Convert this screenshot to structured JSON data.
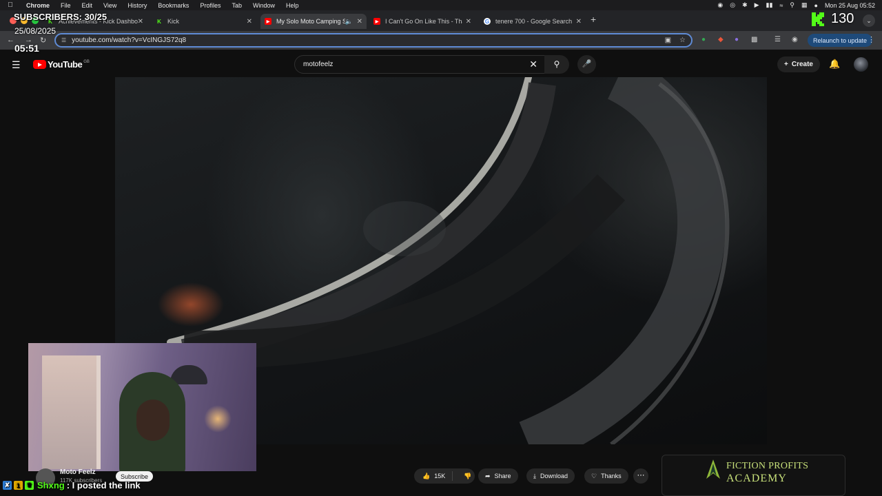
{
  "menubar": {
    "items": [
      "Chrome",
      "File",
      "Edit",
      "View",
      "History",
      "Bookmarks",
      "Profiles",
      "Tab",
      "Window",
      "Help"
    ],
    "datetime": "Mon 25 Aug  05:52"
  },
  "tabs": [
    {
      "title": "Achievements - Kick Dashbo",
      "favicon": "kick-icon"
    },
    {
      "title": "Kick",
      "favicon": "kick-icon"
    },
    {
      "title": "My Solo Moto Camping St",
      "favicon": "youtube-icon",
      "active": true
    },
    {
      "title": "I Can't Go On Like This - Tha",
      "favicon": "youtube-icon"
    },
    {
      "title": "tenere 700 - Google Search",
      "favicon": "google-icon"
    }
  ],
  "address": {
    "url": "youtube.com/watch?v=VcINGJS72q8",
    "relaunch_label": "Relaunch to update"
  },
  "youtube": {
    "logo_text": "YouTube",
    "country": "GB",
    "search_query": "motofeelz",
    "create_label": "Create"
  },
  "video_meta": {
    "channel_name": "Moto Feelz",
    "subscribers": "117K subscribers",
    "subscribe_label": "Subscribe",
    "likes": "15K",
    "share_label": "Share",
    "download_label": "Download",
    "thanks_label": "Thanks"
  },
  "ad": {
    "line1": "FICTION PROFITS",
    "line2": "ACADEMY"
  },
  "overlay": {
    "subscribers": "SUBSCRIBERS: 30/25",
    "date": "25/08/2025",
    "time": "05:51",
    "kick_count": "130",
    "chat_badge_count": "1",
    "chat_user": "Shxng",
    "chat_message": ": I posted the link"
  },
  "colors": {
    "kick_green": "#53fc18",
    "youtube_red": "#ff0000",
    "omnibox_focus": "#5f8bd6"
  }
}
